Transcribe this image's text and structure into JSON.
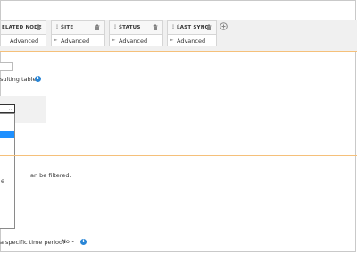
{
  "columns": [
    {
      "label": "ELATED NODE",
      "sub": "Advanced"
    },
    {
      "label": "SITE",
      "sub": "Advanced"
    },
    {
      "label": "STATUS",
      "sub": "Advanced"
    },
    {
      "label": "LAST SYNC",
      "sub": "Advanced"
    }
  ],
  "icons": {
    "drag": "⋮⋮",
    "caret": "►",
    "trash": "trash-icon",
    "add": "plus-circle-icon",
    "info": "i",
    "chevron": "chevron-down-icon"
  },
  "texts": {
    "resulting_table": "sulting table",
    "can_be_filtered": "an be filtered.",
    "specific_time_period": "a specific time period?"
  },
  "dropdown": {
    "partial_option": "e"
  },
  "time_period_select": {
    "value": "No"
  },
  "colors": {
    "accent_orange": "#f5c07a",
    "info_blue": "#2a86d6",
    "selected_option": "#1e90ff"
  }
}
